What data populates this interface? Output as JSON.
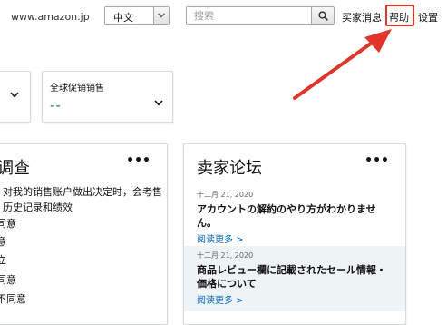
{
  "topbar": {
    "domain": "www.amazon.jp",
    "language": {
      "selected": "中文"
    },
    "search": {
      "placeholder": "搜索"
    },
    "links": {
      "buyer_messages": "买家消息",
      "help": "帮助",
      "settings": "设置"
    }
  },
  "colors": {
    "annotation_red": "#e0352b",
    "link_blue": "#0066c0",
    "promo_teal": "#0b7a75"
  },
  "cards": {
    "promo": {
      "title": "全球促销销售",
      "value": "--"
    },
    "survey": {
      "title": "调查",
      "more": "•••",
      "description": "对我的销售账户做出决定时，会考售历史记录和绩效",
      "options": [
        "同意",
        "意",
        "立",
        "同意",
        "不同意"
      ]
    },
    "forum": {
      "title": "卖家论坛",
      "more": "•••",
      "posts": [
        {
          "date": "十二月 21, 2020",
          "title": "アカウントの解約のやり方がわかりません。",
          "link": "阅读更多 >"
        },
        {
          "date": "十二月 21, 2020",
          "title": "商品レビュー欄に記載されたセール情報・価格について",
          "link": "阅读更多 >"
        }
      ]
    }
  },
  "icons": {
    "language_dropdown": "chevron-down-icon",
    "search": "search-icon",
    "dropdown": "chevron-down-icon",
    "annotation": "arrow-icon"
  }
}
